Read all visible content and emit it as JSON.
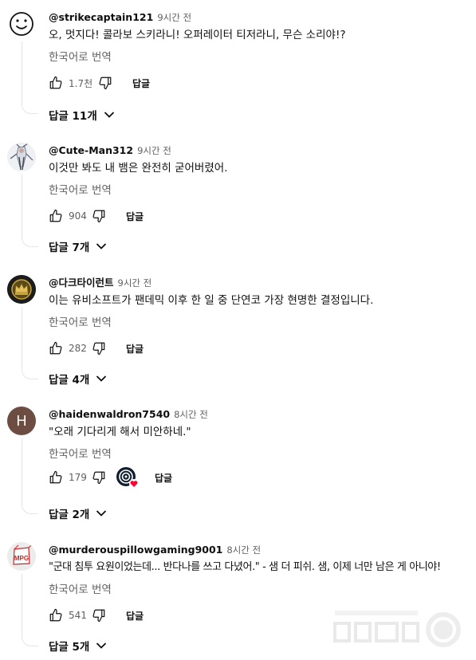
{
  "comments": [
    {
      "author": "@strikecaptain121",
      "time": "9시간 전",
      "text": "오, 멋지다! 콜라보 스키라니! 오퍼레이터 티저라니, 무슨 소리야!?",
      "translate": "한국어로 번역",
      "likes": "1.7천",
      "reply": "답글",
      "replies": "답글 11개"
    },
    {
      "author": "@Cute-Man312",
      "time": "9시간 전",
      "text": "이것만 봐도 내 뱀은 완전히 굳어버렸어.",
      "translate": "한국어로 번역",
      "likes": "904",
      "reply": "답글",
      "replies": "답글 7개"
    },
    {
      "author": "@다크타이런트",
      "time": "9시간 전",
      "text": "이는 유비소프트가 팬데믹 이후 한 일 중 단연코 가장 현명한 결정입니다.",
      "translate": "한국어로 번역",
      "likes": "282",
      "reply": "답글",
      "replies": "답글 4개"
    },
    {
      "author": "@haidenwaldron7540",
      "time": "8시간 전",
      "text": "\"오래 기다리게 해서 미안하네.\"",
      "translate": "한국어로 번역",
      "likes": "179",
      "reply": "답글",
      "replies": "답글 2개",
      "avatar_letter": "H"
    },
    {
      "author": "@murderouspillowgaming9001",
      "time": "8시간 전",
      "text": "\"군대 침투 요원이었는데... 반다나를 쓰고 다녔어.\" - 샘 더 피쉬. 샘, 이제 너만 남은 게 아니야!",
      "translate": "한국어로 번역",
      "likes": "541",
      "reply": "답글",
      "replies": "답글 5개",
      "avatar_text": "MPG"
    }
  ],
  "colors": {
    "text": "#0f0f0f",
    "secondary": "#606060",
    "avatar_h": "#6d4c41",
    "heart": "#ff0033"
  }
}
